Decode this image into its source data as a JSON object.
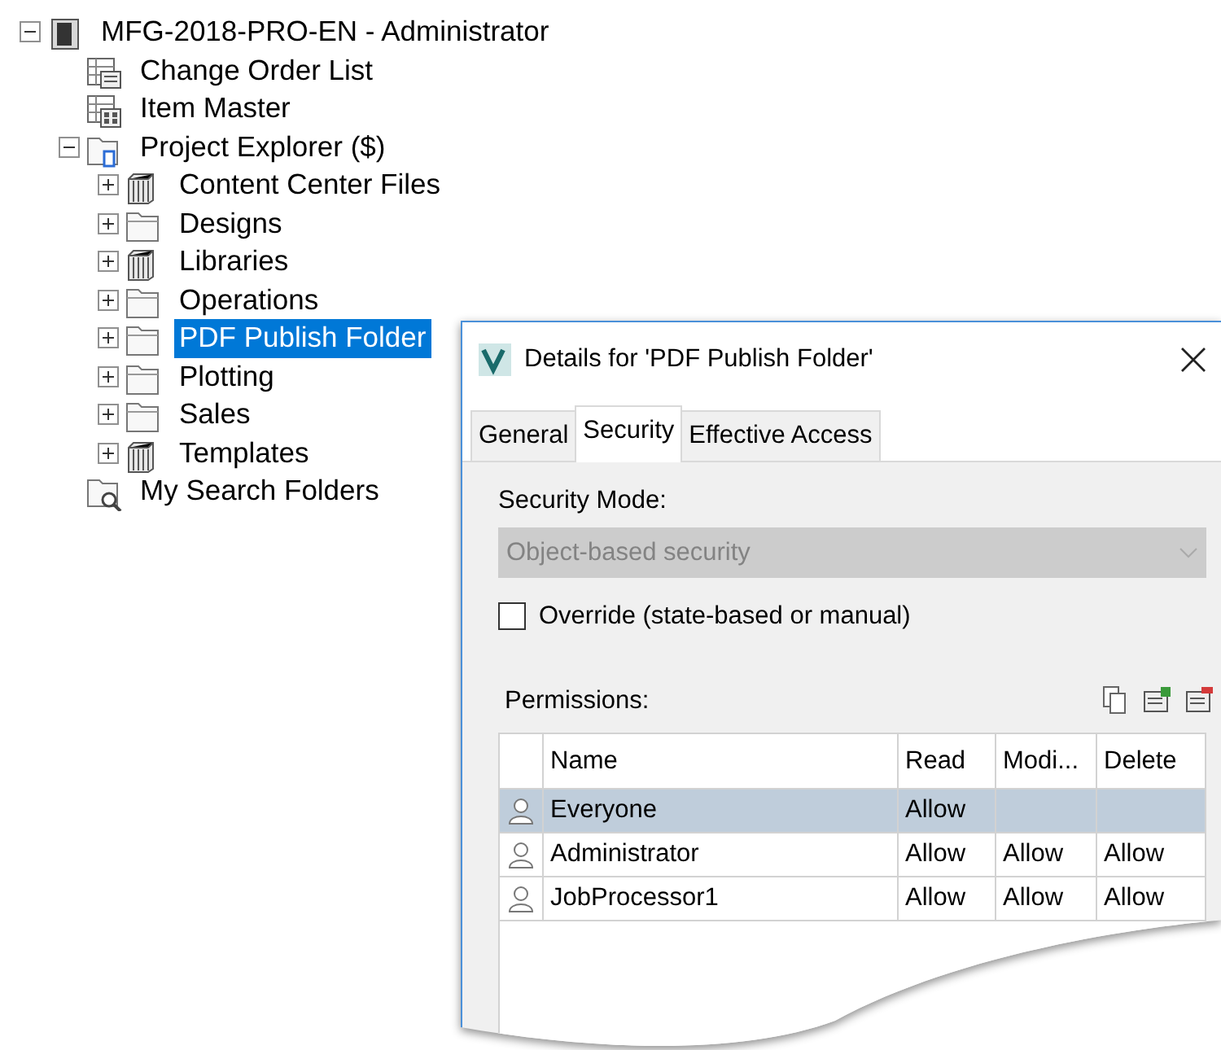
{
  "tree": [
    {
      "label": "MFG-2018-PRO-EN - Administrator",
      "kind": "server",
      "expanded": true,
      "selected": false,
      "children": [
        {
          "label": "Change Order List",
          "kind": "list",
          "selected": false
        },
        {
          "label": "Item Master",
          "kind": "grid",
          "selected": false
        },
        {
          "label": "Project Explorer ($)",
          "kind": "project",
          "expanded": true,
          "selected": false,
          "children": [
            {
              "label": "Content Center Files",
              "kind": "library",
              "expanded": false,
              "selected": false
            },
            {
              "label": "Designs",
              "kind": "folder",
              "expanded": false,
              "selected": false
            },
            {
              "label": "Libraries",
              "kind": "library",
              "expanded": false,
              "selected": false
            },
            {
              "label": "Operations",
              "kind": "folder",
              "expanded": false,
              "selected": false
            },
            {
              "label": "PDF Publish Folder",
              "kind": "folder",
              "expanded": false,
              "selected": true
            },
            {
              "label": "Plotting",
              "kind": "folder",
              "expanded": false,
              "selected": false
            },
            {
              "label": "Sales",
              "kind": "folder",
              "expanded": false,
              "selected": false
            },
            {
              "label": "Templates",
              "kind": "library",
              "expanded": false,
              "selected": false
            }
          ]
        },
        {
          "label": "My Search Folders",
          "kind": "search",
          "selected": false
        }
      ]
    }
  ],
  "dialog": {
    "title": "Details for 'PDF Publish Folder'",
    "tabs": [
      {
        "label": "General",
        "selected": false
      },
      {
        "label": "Security",
        "selected": true
      },
      {
        "label": "Effective Access",
        "selected": false
      }
    ],
    "security_mode": {
      "label": "Security Mode:",
      "value": "Object-based security",
      "disabled": true
    },
    "override": {
      "label": "Override (state-based or manual)",
      "checked": false
    },
    "permissions": {
      "label": "Permissions:",
      "columns": [
        "Name",
        "Read",
        "Modi...",
        "Delete"
      ],
      "rows": [
        {
          "cells": [
            "Everyone",
            "Allow",
            "",
            ""
          ],
          "selected": true
        },
        {
          "cells": [
            "Administrator",
            "Allow",
            "Allow",
            "Allow"
          ],
          "selected": false
        },
        {
          "cells": [
            "JobProcessor1",
            "Allow",
            "Allow",
            "Allow"
          ],
          "selected": false
        }
      ]
    }
  }
}
